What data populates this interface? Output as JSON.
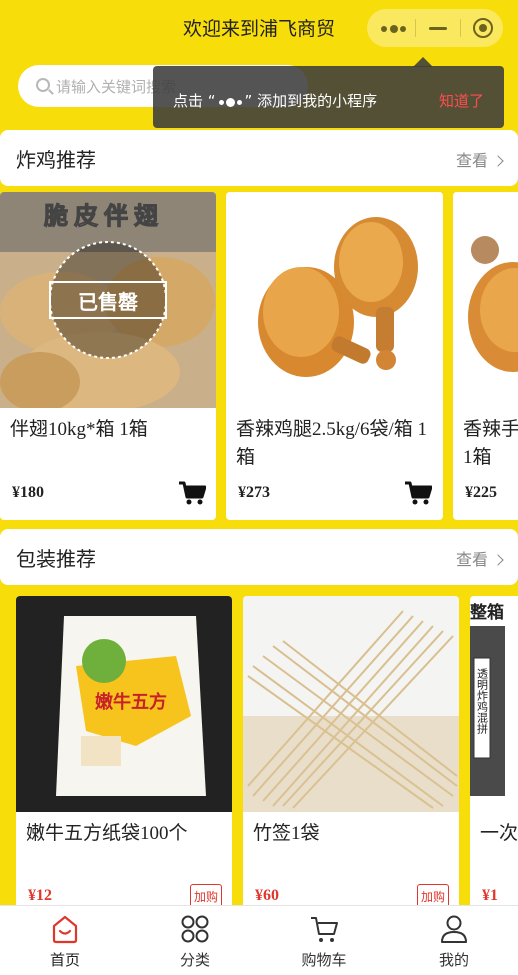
{
  "header": {
    "title": "欢迎来到浦飞商贸"
  },
  "search": {
    "placeholder": "请输入关键词搜索"
  },
  "tooltip": {
    "text_before": "点击 “",
    "text_after": "” 添加到我的小程序",
    "dismiss_label": "知道了"
  },
  "sections": [
    {
      "title": "炸鸡推荐",
      "more_label": "查看",
      "products": [
        {
          "name": "伴翅10kg*箱 1箱",
          "price": "¥180",
          "image_text": "脆皮伴翅",
          "badge": "已售罄"
        },
        {
          "name": "香辣鸡腿2.5kg/6袋/箱 1箱",
          "price": "¥273"
        },
        {
          "name": "香辣手 1箱",
          "price": "¥225"
        }
      ]
    },
    {
      "title": "包装推荐",
      "more_label": "查看",
      "products": [
        {
          "name": "嫩牛五方纸袋100个",
          "price": "¥12",
          "add_label": "加购",
          "image_text": "嫩牛五方"
        },
        {
          "name": "竹签1袋",
          "price": "¥60",
          "add_label": "加购"
        },
        {
          "name": "一次",
          "price": "¥1",
          "image_text_top": "整箱",
          "image_text_side": "透明炸鸡混拼"
        }
      ]
    }
  ],
  "tabbar": [
    {
      "label": "首页",
      "icon": "home-icon",
      "active": true
    },
    {
      "label": "分类",
      "icon": "category-icon"
    },
    {
      "label": "购物车",
      "icon": "cart-icon"
    },
    {
      "label": "我的",
      "icon": "user-icon"
    }
  ],
  "colors": {
    "brand_yellow": "#f7dd0a",
    "price_red": "#e0362c",
    "tab_active": "#e0362c"
  }
}
